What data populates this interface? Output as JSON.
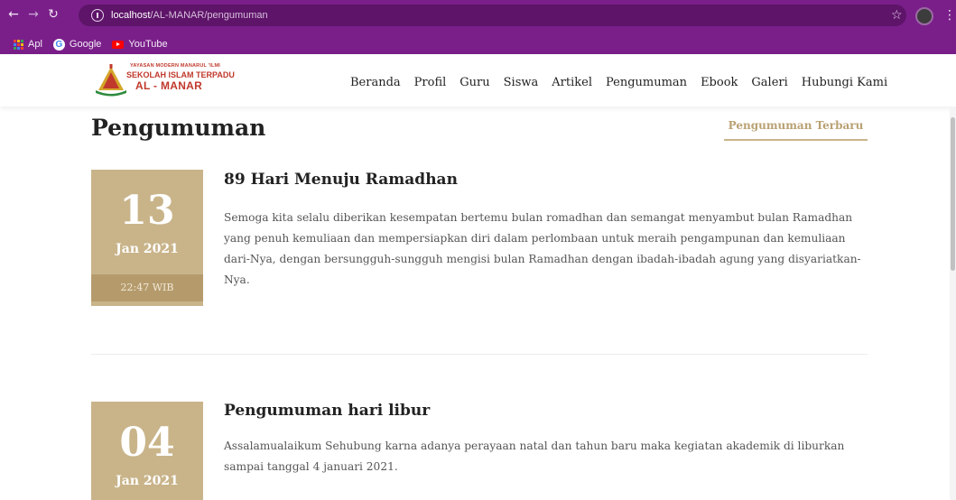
{
  "browser": {
    "url_host": "localhost",
    "url_path": "/AL-MANAR/pengumuman",
    "bookmarks": [
      {
        "label": "Apl",
        "icon": "apps-grid-icon"
      },
      {
        "label": "Google",
        "icon": "google-icon"
      },
      {
        "label": "YouTube",
        "icon": "youtube-icon"
      }
    ]
  },
  "site": {
    "logo": {
      "line1": "YAYASAN MODERN MANARUL 'ILMI",
      "line2": "SEKOLAH ISLAM TERPADU",
      "line3": "AL - MANAR"
    },
    "nav": [
      "Beranda",
      "Profil",
      "Guru",
      "Siswa",
      "Artikel",
      "Pengumuman",
      "Ebook",
      "Galeri",
      "Hubungi Kami"
    ]
  },
  "page": {
    "title": "Pengumuman",
    "latest_tab": "Pengumuman Terbaru"
  },
  "posts": [
    {
      "day": "13",
      "month": "Jan 2021",
      "time": "22:47 WIB",
      "title": "89 Hari Menuju Ramadhan",
      "body": "Semoga kita selalu diberikan kesempatan bertemu bulan romadhan dan semangat menyambut bulan Ramadhan yang penuh kemuliaan dan mempersiapkan diri dalam perlombaan untuk meraih pengampunan dan kemuliaan dari-Nya, dengan bersungguh-sungguh mengisi bulan Ramadhan dengan ibadah-ibadah agung yang disyariatkan-Nya."
    },
    {
      "day": "04",
      "month": "Jan 2021",
      "title": "Pengumuman hari libur",
      "body": "Assalamualaikum Sehubung karna adanya perayaan natal dan tahun baru maka kegiatan akademik di liburkan sampai tanggal 4 januari 2021."
    }
  ],
  "colors": {
    "browser_frame": "#7a1f8a",
    "date_box": "#c9b48a",
    "date_time_bar": "#b59b6c",
    "logo_red": "#c0392b"
  }
}
